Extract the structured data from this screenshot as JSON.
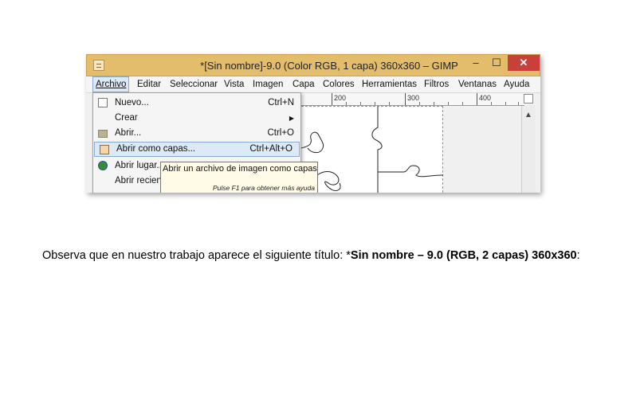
{
  "window": {
    "title": "*[Sin nombre]-9.0 (Color RGB, 1 capa) 360x360 – GIMP",
    "minimize_glyph": "–",
    "maximize_glyph": "☐",
    "close_glyph": "✕"
  },
  "menubar": {
    "items": [
      "Archivo",
      "Editar",
      "Seleccionar",
      "Vista",
      "Imagen",
      "Capa",
      "Colores",
      "Herramientas",
      "Filtros",
      "Ventanas",
      "Ayuda"
    ],
    "active": "Archivo"
  },
  "ruler": {
    "labels": [
      "200",
      "300",
      "400"
    ]
  },
  "archivo_menu": {
    "items": [
      {
        "label": "Nuevo...",
        "accel": "Ctrl+N",
        "icon": "new-document-icon"
      },
      {
        "label": "Crear",
        "accel": "",
        "icon": "",
        "submenu": true
      },
      {
        "label": "Abrir...",
        "accel": "Ctrl+O",
        "icon": "folder-icon"
      },
      {
        "label": "Abrir como capas...",
        "accel": "Ctrl+Alt+O",
        "icon": "open-as-layers-icon",
        "selected": true
      },
      {
        "label": "Abrir lugar...",
        "accel": "",
        "icon": "globe-icon"
      },
      {
        "label": "Abrir recien",
        "accel": "",
        "icon": ""
      }
    ]
  },
  "tooltip": {
    "text": "Abrir un archivo de imagen como capas",
    "hint": "Pulse F1 para obtener más ayuda"
  },
  "caption": {
    "prefix": "Observa que en nuestro trabajo aparece el siguiente título: *",
    "bold": "Sin nombre – 9.0 (RGB, 2 capas) 360x360",
    "suffix": ":"
  },
  "colors": {
    "titlebar": "#e3bd6c",
    "close_button": "#c7403a",
    "selection": "#dce9f7",
    "tooltip_bg": "#fffbe6"
  }
}
